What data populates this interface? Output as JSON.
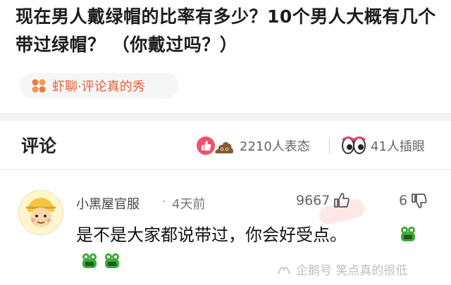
{
  "article": {
    "title": "现在男人戴绿帽的比率有多少？10个男人大概有几个带过绿帽？ （你戴过吗？）",
    "source_tag": "虾聊·评论真的秀",
    "tag_color": "#e0623a"
  },
  "comments_section": {
    "title": "评论",
    "reactions": [
      {
        "label": "2210人表态",
        "icons": [
          "thumb-up-icon",
          "poop-icon"
        ]
      },
      {
        "label": "41人插眼",
        "icons": [
          "eyes-icon"
        ]
      }
    ]
  },
  "comment": {
    "username": "小黑屋官服",
    "separator": "·",
    "time": "4天前",
    "likes": "9667",
    "dislikes": "6",
    "text": "是不是大家都说带过，你会好受点。",
    "emoji": "frog-emoji"
  },
  "watermark": {
    "text": "企鹅号 笑点真的很低"
  }
}
